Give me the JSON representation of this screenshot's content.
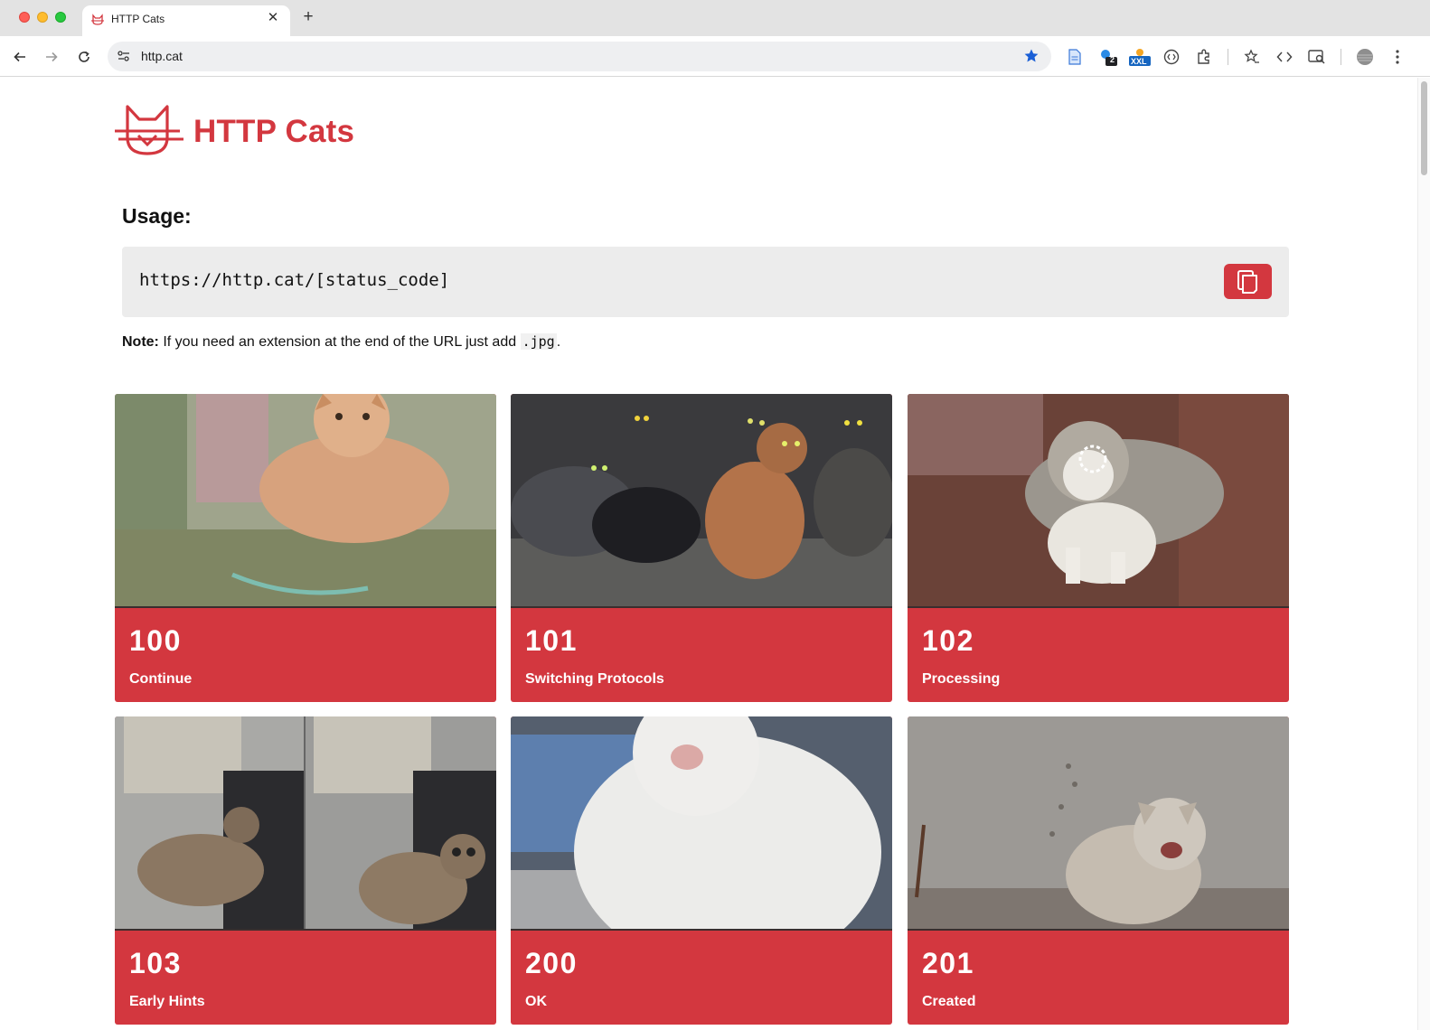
{
  "browser": {
    "tab_title": "HTTP Cats",
    "url": "http.cat",
    "extension_badge": "2",
    "extension_xxl": "XXL"
  },
  "header": {
    "site_title": "HTTP Cats"
  },
  "usage": {
    "heading": "Usage:",
    "code": "https://http.cat/[status_code]",
    "note_bold": "Note:",
    "note_text": " If you need an extension at the end of the URL just add ",
    "note_code": ".jpg",
    "note_end": "."
  },
  "cards": [
    {
      "code": "100",
      "label": "Continue"
    },
    {
      "code": "101",
      "label": "Switching Protocols"
    },
    {
      "code": "102",
      "label": "Processing"
    },
    {
      "code": "103",
      "label": "Early Hints"
    },
    {
      "code": "200",
      "label": "OK"
    },
    {
      "code": "201",
      "label": "Created"
    }
  ],
  "colors": {
    "brand_red": "#d3373f",
    "code_background": "#ececec"
  }
}
